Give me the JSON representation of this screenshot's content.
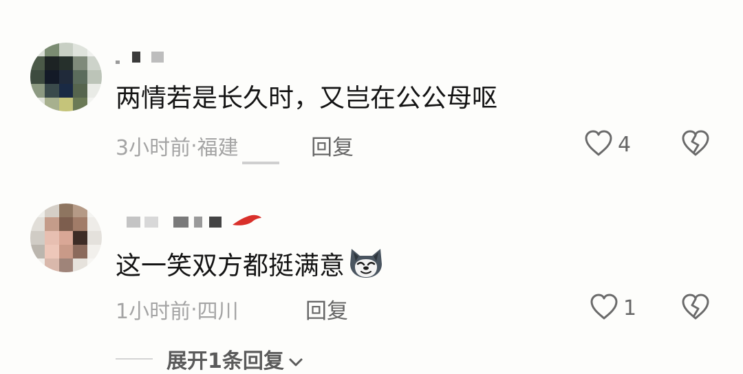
{
  "comments": [
    {
      "text": "两情若是长久时，又岂在公公母呕",
      "time": "3小时前",
      "separator": " · ",
      "location": "福建",
      "reply_label": "回复",
      "like_count": "4"
    },
    {
      "text": "这一笑双方都挺满意",
      "emoji": "wolf-face-emoji",
      "time": "1小时前",
      "separator": " · ",
      "location": "四川",
      "reply_label": "回复",
      "like_count": "1"
    }
  ],
  "expand_replies": {
    "label": "展开1条回复"
  },
  "icons": {
    "like": "heart-outline-icon",
    "dislike": "broken-heart-icon",
    "expand": "chevron-down-icon"
  },
  "colors": {
    "text": "#141414",
    "meta": "#a4a4a4",
    "action": "#666666"
  }
}
